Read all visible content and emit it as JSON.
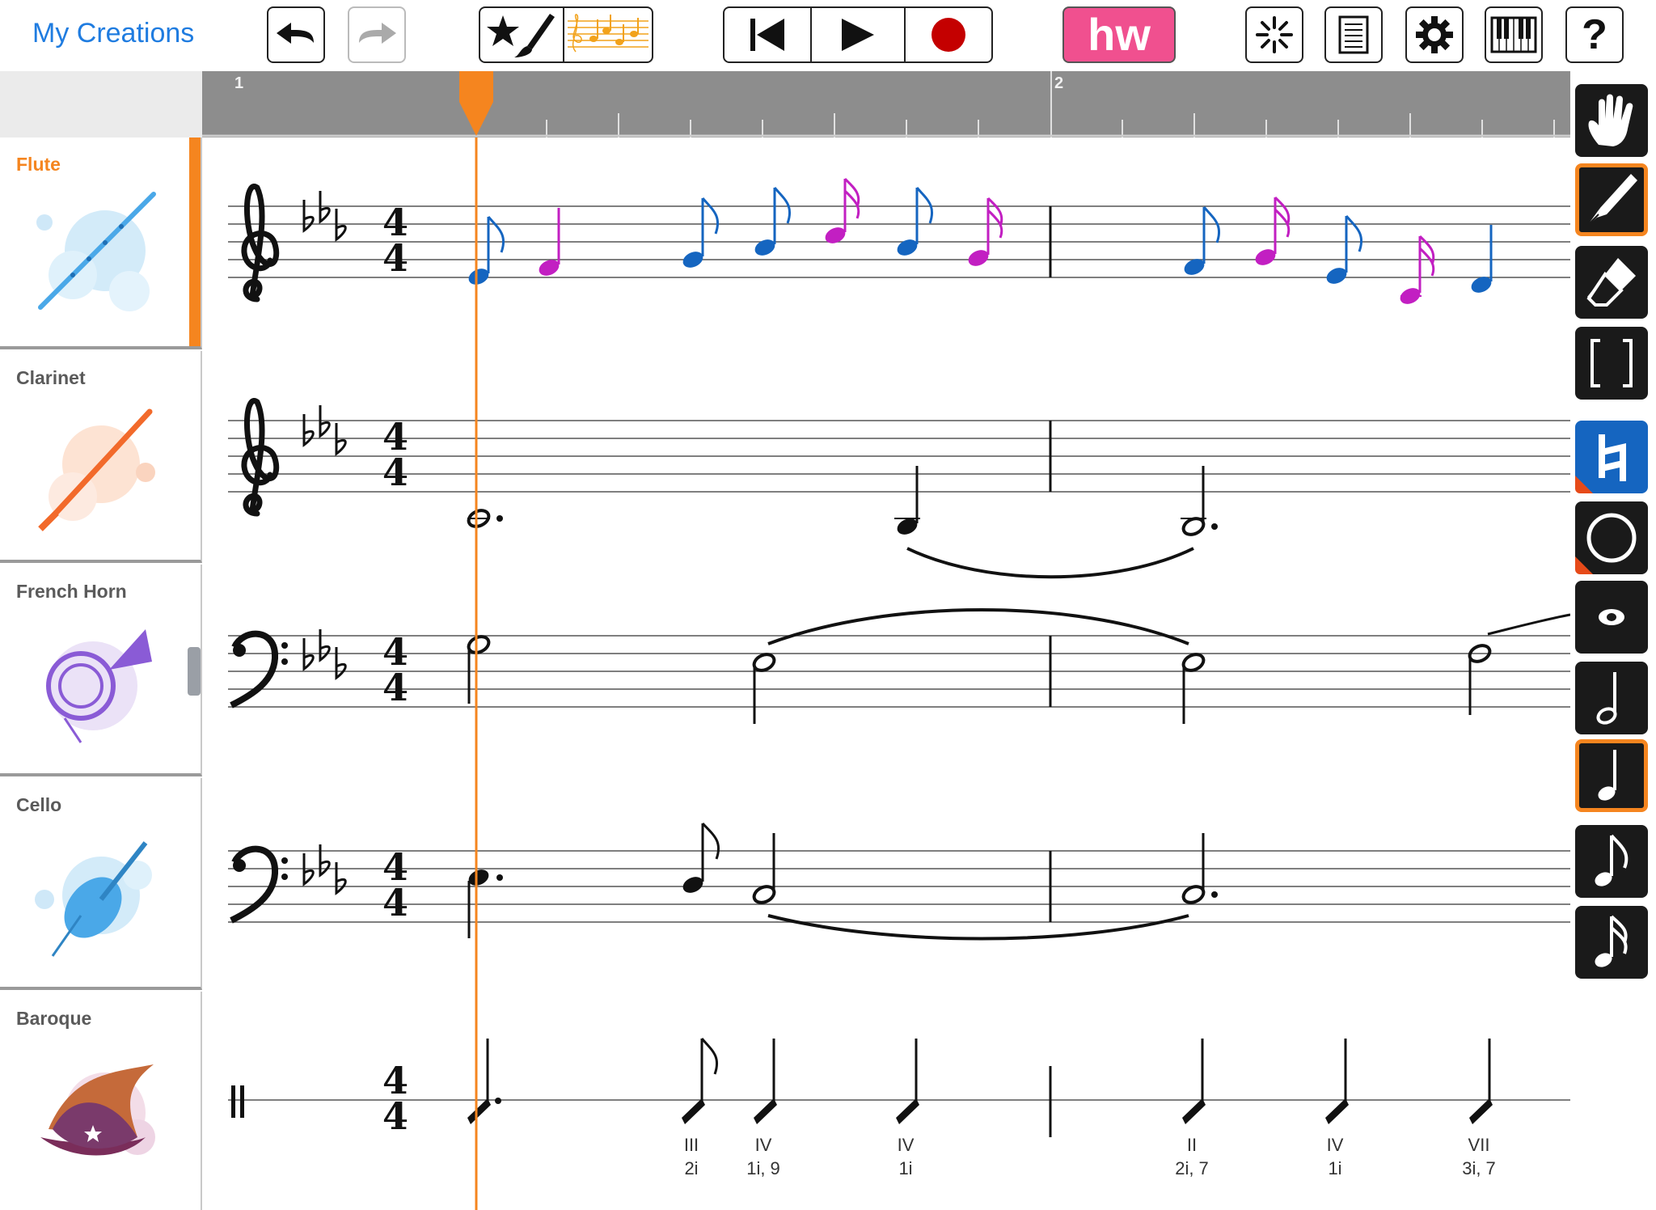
{
  "header": {
    "my_creations": "My Creations",
    "hw_label": "hw",
    "help_label": "?"
  },
  "ruler": {
    "measures": [
      "1",
      "2"
    ]
  },
  "tracks": [
    {
      "name": "Flute",
      "active": true,
      "icon": "flute-icon",
      "accent": "#4aa8e8"
    },
    {
      "name": "Clarinet",
      "active": false,
      "icon": "clarinet-icon",
      "accent": "#f26a2b"
    },
    {
      "name": "French Horn",
      "active": false,
      "icon": "french-horn-icon",
      "accent": "#8a5bd6"
    },
    {
      "name": "Cello",
      "active": false,
      "icon": "cello-icon",
      "accent": "#4aa8e8"
    },
    {
      "name": "Baroque",
      "active": false,
      "icon": "wizard-hat-icon",
      "accent": "#7a3a6b"
    }
  ],
  "score": {
    "time_signature": [
      "4",
      "4"
    ],
    "chords": [
      {
        "numeral": "III",
        "figure": "2i"
      },
      {
        "numeral": "IV",
        "figure": "1i, 9"
      },
      {
        "numeral": "IV",
        "figure": "1i"
      },
      {
        "numeral": "II",
        "figure": "2i, 7"
      },
      {
        "numeral": "IV",
        "figure": "1i"
      },
      {
        "numeral": "VII",
        "figure": "3i, 7"
      }
    ]
  },
  "colors": {
    "accent": "#f5851f",
    "link": "#1f7ce0",
    "note_blue": "#1565c0",
    "note_magenta": "#c21fc2",
    "hw_pink": "#f0508f",
    "record_red": "#c40000"
  },
  "right_tools": [
    {
      "name": "hand-tool",
      "icon": "hand-icon",
      "selected": false
    },
    {
      "name": "pen-tool",
      "icon": "pen-icon",
      "selected": true
    },
    {
      "name": "eraser-tool",
      "icon": "eraser-icon",
      "selected": false
    },
    {
      "name": "bracket-tool",
      "icon": "bracket-icon",
      "selected": false
    },
    {
      "name": "natural-tool",
      "icon": "natural-icon",
      "selected": false
    },
    {
      "name": "whole-note-tool",
      "icon": "whole-note-icon",
      "selected": false
    },
    {
      "name": "eye-tool",
      "icon": "eye-icon",
      "selected": false
    },
    {
      "name": "half-note-tool",
      "icon": "half-note-icon",
      "selected": false
    },
    {
      "name": "quarter-note-tool",
      "icon": "quarter-note-icon",
      "selected": true
    },
    {
      "name": "eighth-note-tool",
      "icon": "eighth-note-icon",
      "selected": false
    },
    {
      "name": "sixteenth-note-tool",
      "icon": "sixteenth-note-icon",
      "selected": false
    }
  ]
}
